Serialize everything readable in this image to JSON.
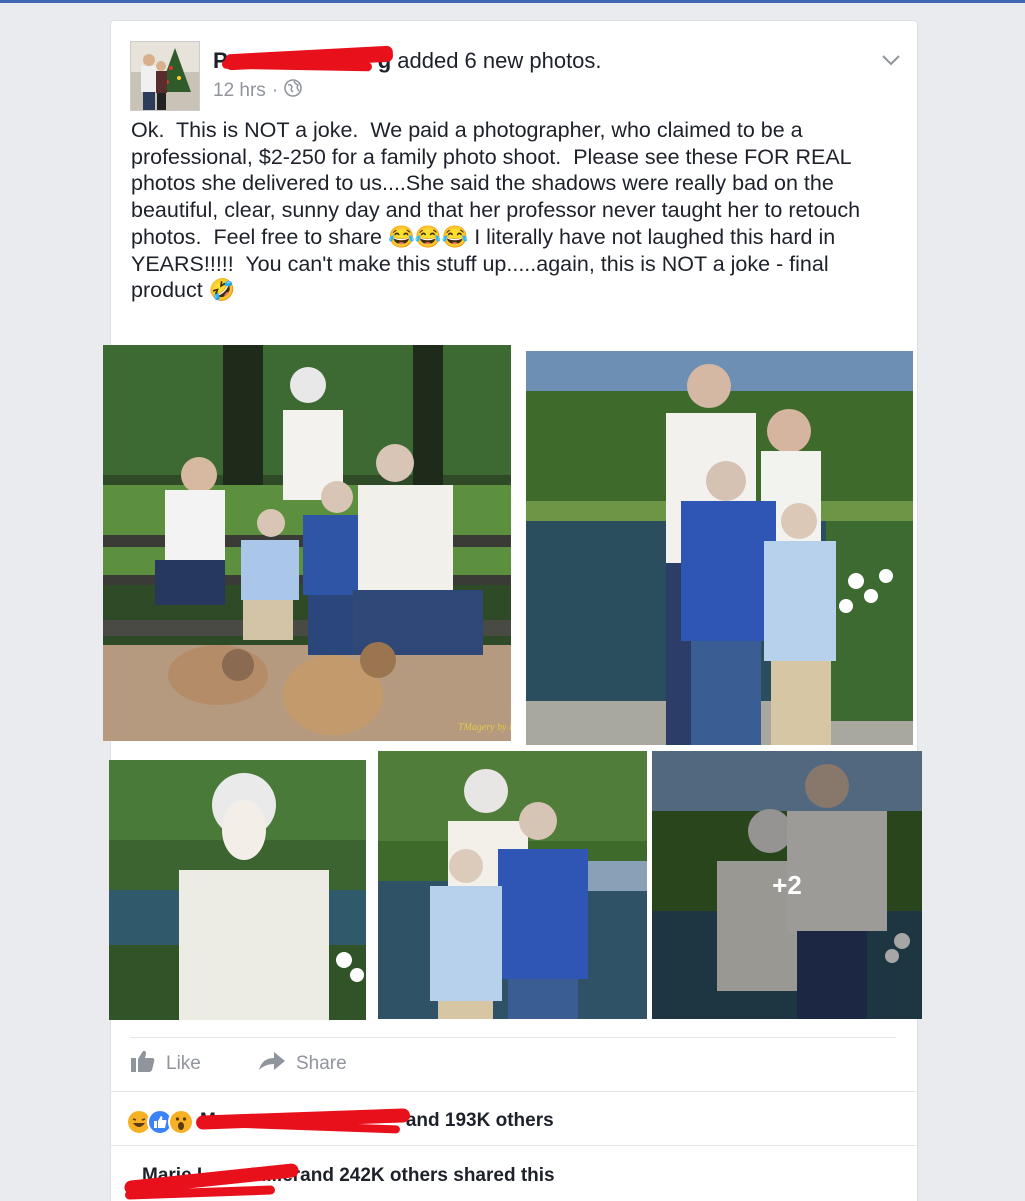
{
  "post": {
    "author_visible": "Pa g",
    "author_prefix": "P",
    "author_suffix": "g",
    "action": " added 6 new photos.",
    "time": "12 hrs",
    "dot": "·",
    "text": "Ok.  This is NOT a joke.  We paid a photographer, who claimed to be a professional, $2-250 for a family photo shoot.  Please see these FOR REAL photos she delivered to us....She said the shadows were really bad on the beautiful, clear, sunny day and that her professor never taught her to retouch photos.  Feel free to share 😂😂😂 I literally have not laughed this hard in YEARS!!!!!  You can't make this stuff up.....again, this is NOT a joke - final product 🤣",
    "icons": {
      "audience": "globe-icon",
      "menu": "chevron-down-icon"
    }
  },
  "photos": {
    "watermark": "TMagery by L",
    "more_count": "+2"
  },
  "actions": {
    "like": "Like",
    "share": "Share",
    "like_icon": "thumbs-up-icon",
    "share_icon": "share-arrow-icon"
  },
  "stats": {
    "reactions_text": "and 193K others",
    "reactions_prefix": "M",
    "reaction_icons": [
      "haha-icon",
      "like-icon",
      "wow-icon"
    ],
    "shares_text": "and 242K others shared this",
    "shares_prefix": "Marie L",
    "shares_suffix": "Miller"
  },
  "colors": {
    "background": "#e9ebee",
    "card": "#ffffff",
    "redaction": "#e8101a",
    "secondary_text": "#90949c",
    "brand": "#4267b2"
  }
}
